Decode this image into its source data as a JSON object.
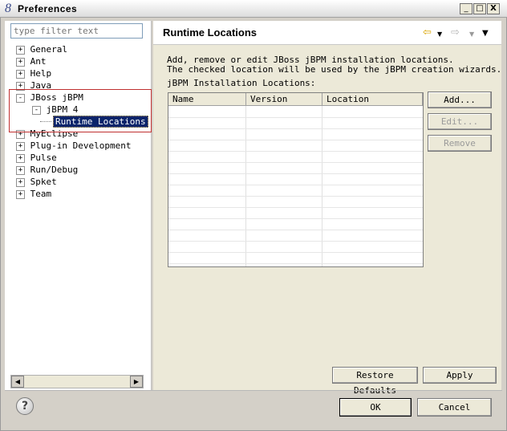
{
  "window": {
    "title": "Preferences",
    "minimize": "_",
    "maximize": "□",
    "close": "X"
  },
  "filter": {
    "placeholder": "type filter text"
  },
  "tree": {
    "items": [
      {
        "label": "General",
        "expander": "+"
      },
      {
        "label": "Ant",
        "expander": "+"
      },
      {
        "label": "Help",
        "expander": "+"
      },
      {
        "label": "Java",
        "expander": "+"
      },
      {
        "label": "JBoss jBPM",
        "expander": "-"
      },
      {
        "label": "jBPM 4",
        "expander": "-"
      },
      {
        "label": "Runtime Locations"
      },
      {
        "label": "MyEclipse",
        "expander": "+"
      },
      {
        "label": "Plug-in Development",
        "expander": "+"
      },
      {
        "label": "Pulse",
        "expander": "+"
      },
      {
        "label": "Run/Debug",
        "expander": "+"
      },
      {
        "label": "Spket",
        "expander": "+"
      },
      {
        "label": "Team",
        "expander": "+"
      }
    ]
  },
  "page": {
    "title": "Runtime Locations",
    "desc_line1": "Add, remove or edit JBoss jBPM installation locations.",
    "desc_line2": "The checked location will be used by the jBPM creation wizards.",
    "table_label": "jBPM Installation Locations:",
    "columns": [
      "Name",
      "Version",
      "Location"
    ],
    "add": "Add...",
    "edit": "Edit...",
    "remove": "Remove",
    "restore_defaults": "Restore Defaults",
    "apply": "Apply"
  },
  "footer": {
    "help": "?",
    "ok": "OK",
    "cancel": "Cancel"
  },
  "icons": {
    "back": "back-arrow-icon",
    "forward": "forward-arrow-icon",
    "menu": "view-menu-icon"
  },
  "colors": {
    "selection": "#0a246a",
    "highlight_box": "#c03030"
  }
}
